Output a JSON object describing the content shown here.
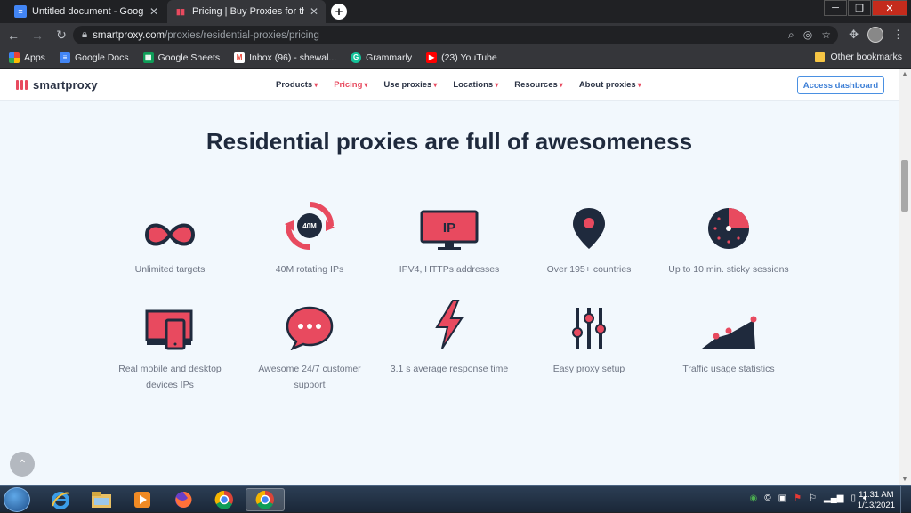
{
  "browser": {
    "tabs": [
      {
        "title": "Untitled document - Google Doc",
        "active": false
      },
      {
        "title": "Pricing | Buy Proxies for the Best",
        "active": true
      }
    ],
    "new_tab": "+",
    "url_host": "smartproxy.com",
    "url_path": "/proxies/residential-proxies/pricing",
    "bookmarks": [
      {
        "label": "Apps",
        "icon": "apps-grid-icon"
      },
      {
        "label": "Google Docs",
        "icon": "google-docs-icon"
      },
      {
        "label": "Google Sheets",
        "icon": "google-sheets-icon"
      },
      {
        "label": "Inbox (96) - shewal...",
        "icon": "gmail-icon"
      },
      {
        "label": "Grammarly",
        "icon": "grammarly-icon"
      },
      {
        "label": "(23) YouTube",
        "icon": "youtube-icon"
      }
    ],
    "other_bookmarks": "Other bookmarks"
  },
  "site": {
    "logo": "smartproxy",
    "menu": [
      {
        "label": "Products",
        "active": false
      },
      {
        "label": "Pricing",
        "active": true
      },
      {
        "label": "Use proxies",
        "active": false
      },
      {
        "label": "Locations",
        "active": false
      },
      {
        "label": "Resources",
        "active": false
      },
      {
        "label": "About proxies",
        "active": false
      }
    ],
    "dashboard_button": "Access dashboard",
    "heading": "Residential proxies are full of awesomeness",
    "features": [
      {
        "label": "Unlimited targets",
        "icon": "infinity-icon"
      },
      {
        "label": "40M rotating IPs",
        "icon": "rotating-ips-icon",
        "badge": "40M"
      },
      {
        "label": "IPV4, HTTPs addresses",
        "icon": "ip-monitor-icon",
        "badge": "IP"
      },
      {
        "label": "Over 195+ countries",
        "icon": "location-pin-icon"
      },
      {
        "label": "Up to 10 min. sticky sessions",
        "icon": "timer-icon"
      },
      {
        "label": "Real mobile and desktop devices IPs",
        "icon": "devices-icon"
      },
      {
        "label": "Awesome 24/7 customer support",
        "icon": "chat-bubble-icon"
      },
      {
        "label": "3.1 s average response time",
        "icon": "lightning-icon"
      },
      {
        "label": "Easy proxy setup",
        "icon": "sliders-icon"
      },
      {
        "label": "Traffic usage statistics",
        "icon": "chart-icon"
      }
    ]
  },
  "taskbar": {
    "time": "11:31 AM",
    "date": "1/13/2021"
  },
  "colors": {
    "accent": "#e84a5f",
    "dark": "#1f2a3d",
    "page_bg": "#f2f8fd",
    "link_blue": "#3d7fd6"
  }
}
